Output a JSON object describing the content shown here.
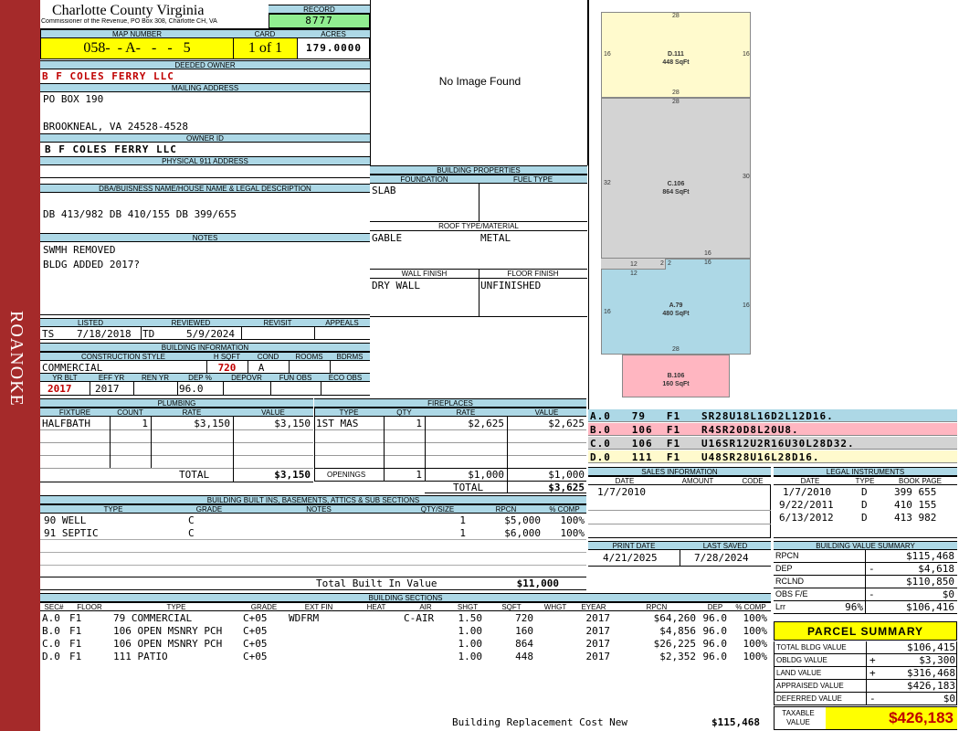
{
  "sidebar": {
    "label": "ROANOKE"
  },
  "county": {
    "name": "Charlotte County Virginia",
    "sub": "Commissioner of the Revenue, PO Box 308, Charlotte CH, VA"
  },
  "record": {
    "label": "RECORD",
    "value": "8777"
  },
  "map": {
    "label": "MAP NUMBER",
    "value": "058-  - A-   -   -   5",
    "card_label": "CARD",
    "card": "1 of 1",
    "acres_label": "ACRES",
    "acres": "179.0000"
  },
  "owner": {
    "deeded_label": "DEEDED OWNER",
    "deeded": "B F COLES FERRY LLC",
    "mailing_label": "MAILING ADDRESS",
    "addr1": "PO BOX 190",
    "addr2": "BROOKNEAL, VA 24528-4528",
    "id_label": "OWNER ID",
    "id_value": "B F COLES FERRY LLC",
    "phys_label": "PHYSICAL 911 ADDRESS"
  },
  "dba": {
    "label": "DBA/BUISNESS NAME/HOUSE NAME & LEGAL DESCRIPTION",
    "value": "DB 413/982 DB 410/155 DB 399/655"
  },
  "notes": {
    "label": "NOTES",
    "line1": "SWMH REMOVED",
    "line2": "BLDG ADDED 2017?"
  },
  "listed": {
    "h_listed": "LISTED",
    "h_reviewed": "REVIEWED",
    "h_revisit": "REVISIT",
    "h_appeals": "APPEALS",
    "lister": "TS",
    "listed_date": "7/18/2018",
    "reviewer": "TD",
    "reviewed_date": "5/9/2024"
  },
  "bldg_info": {
    "label": "BUILDING INFORMATION",
    "h_style": "CONSTRUCTION STYLE",
    "h_hsqft": "H SQFT",
    "h_cond": "COND",
    "h_rooms": "ROOMS",
    "h_bdrms": "BDRMS",
    "style": "COMMERCIAL",
    "hsqft": "720",
    "cond": "A",
    "h_yrblt": "YR BLT",
    "h_effyr": "EFF YR",
    "h_renyr": "REN YR",
    "h_dep": "DEP %",
    "h_depovr": "DEPOVR",
    "h_funobs": "FUN OBS",
    "h_ecoobs": "ECO OBS",
    "yrblt": "2017",
    "effyr": "2017",
    "dep": "96.0"
  },
  "plumbing": {
    "label": "PLUMBING",
    "h_fixture": "FIXTURE",
    "h_count": "COUNT",
    "h_rate": "RATE",
    "h_value": "VALUE",
    "fixture": "HALFBATH",
    "count": "1",
    "rate": "$3,150",
    "value": "$3,150",
    "total_label": "TOTAL",
    "total": "$3,150"
  },
  "fireplaces": {
    "label": "FIREPLACES",
    "h_type": "TYPE",
    "h_qty": "QTY",
    "h_rate": "RATE",
    "h_value": "VALUE",
    "type": "1ST MAS",
    "qty": "1",
    "rate": "$2,625",
    "value": "$2,625",
    "openings_label": "OPENINGS",
    "open_qty": "1",
    "open_rate": "$1,000",
    "open_value": "$1,000",
    "total_label": "TOTAL",
    "total": "$3,625"
  },
  "image": {
    "no_image": "No Image Found"
  },
  "bldg_props": {
    "label": "BUILDING PROPERTIES",
    "h_foundation": "FOUNDATION",
    "h_fuel": "FUEL TYPE",
    "foundation": "SLAB",
    "h_roof": "ROOF TYPE/MATERIAL",
    "roof1": "GABLE",
    "roof2": "METAL",
    "h_wall": "WALL FINISH",
    "h_floor": "FLOOR FINISH",
    "wall": "DRY WALL",
    "floor": "UNFINISHED"
  },
  "sketch": {
    "d": {
      "name": "D.111",
      "area": "448 SqFt",
      "top": "28",
      "left": "16",
      "right": "16",
      "bottom": "28"
    },
    "c": {
      "name": "C.106",
      "area": "864 SqFt",
      "top": "28",
      "left": "32",
      "right": "30",
      "s16": "16",
      "s12": "12",
      "s2a": "2",
      "s2b": "2",
      "s16b": "16"
    },
    "a": {
      "name": "A.79",
      "area": "480 SqFt",
      "left": "16",
      "right": "16",
      "top": "12",
      "bottom": "28"
    },
    "b": {
      "name": "B.106",
      "area": "160 SqFt"
    }
  },
  "sketch_legend": [
    {
      "text": "A.0   79   F1   SR28U18L16D2L12D16.",
      "color": "#add8e6"
    },
    {
      "text": "B.0   106  F1   R4SR20D8L20U8.",
      "color": "#ffb6c1"
    },
    {
      "text": "C.0   106  F1   U16SR12U2R16U30L28D32.",
      "color": "#d3d3d3"
    },
    {
      "text": "D.0   111  F1   U48SR28U16L28D16.",
      "color": "#fffacd"
    }
  ],
  "sales": {
    "label": "SALES INFORMATION",
    "h_date": "DATE",
    "h_amount": "AMOUNT",
    "h_code": "CODE",
    "date": "1/7/2010"
  },
  "legal": {
    "label": "LEGAL INSTRUMENTS",
    "h_date": "DATE",
    "h_type": "TYPE",
    "h_book": "BOOK PAGE",
    "rows": [
      {
        "date": "1/7/2010",
        "type": "D",
        "book": "399 655"
      },
      {
        "date": "9/22/2011",
        "type": "D",
        "book": "410 155"
      },
      {
        "date": "6/13/2012",
        "type": "D",
        "book": "413 982"
      }
    ]
  },
  "print": {
    "h_print": "PRINT DATE",
    "h_saved": "LAST SAVED",
    "print_date": "4/21/2025",
    "saved_date": "7/28/2024"
  },
  "bvs": {
    "label": "BUILDING VALUE SUMMARY",
    "rows": [
      {
        "k": "RPCN",
        "s": "",
        "v": "$115,468"
      },
      {
        "k": "DEP",
        "s": "-",
        "v": "$4,618"
      },
      {
        "k": "RCLND",
        "s": "",
        "v": "$110,850"
      },
      {
        "k": "OBS F/E",
        "s": "-",
        "v": "$0"
      },
      {
        "k": "Lrr",
        "p": "96%",
        "s": "",
        "v": "$106,416"
      }
    ]
  },
  "parcel": {
    "label": "PARCEL SUMMARY",
    "rows": [
      {
        "k": "TOTAL BLDG VALUE",
        "s": "",
        "v": "$106,415"
      },
      {
        "k": "OBLDG VALUE",
        "s": "+",
        "v": "$3,300"
      },
      {
        "k": "LAND VALUE",
        "s": "+",
        "v": "$316,468"
      },
      {
        "k": "APPRAISED VALUE",
        "s": "",
        "v": "$426,183"
      },
      {
        "k": "DEFERRED VALUE",
        "s": "-",
        "v": "$0"
      }
    ],
    "taxable_label1": "TAXABLE",
    "taxable_label2": "VALUE",
    "taxable": "$426,183"
  },
  "builtins": {
    "label": "BUILDING BUILT INS, BASEMENTS, ATTICS & SUB SECTIONS",
    "h_type": "TYPE",
    "h_grade": "GRADE",
    "h_notes": "NOTES",
    "h_qty": "QTY/SIZE",
    "h_rpcn": "RPCN",
    "h_comp": "% COMP",
    "rows": [
      {
        "type": "90 WELL",
        "grade": "C",
        "qty": "1",
        "rpcn": "$5,000",
        "comp": "100%"
      },
      {
        "type": "91 SEPTIC",
        "grade": "C",
        "qty": "1",
        "rpcn": "$6,000",
        "comp": "100%"
      }
    ],
    "total_label": "Total Built In Value",
    "total": "$11,000"
  },
  "sections": {
    "label": "BUILDING SECTIONS",
    "headers": [
      "SEC#",
      "FLOOR",
      "TYPE",
      "GRADE",
      "EXT FIN",
      "HEAT",
      "AIR",
      "SHGT",
      "SQFT",
      "WHGT",
      "EYEAR",
      "RPCN",
      "DEP",
      "% COMP"
    ],
    "rows": [
      {
        "sec": "A.0",
        "floor": "F1",
        "type": "79 COMMERCIAL",
        "grade": "C+05",
        "ext": "WDFRM",
        "heat": "",
        "air": "C-AIR",
        "shgt": "1.50",
        "sqft": "720",
        "whgt": "",
        "eyear": "2017",
        "rpcn": "$64,260",
        "dep": "96.0",
        "comp": "100%"
      },
      {
        "sec": "B.0",
        "floor": "F1",
        "type": "106 OPEN MSNRY PCH",
        "grade": "C+05",
        "ext": "",
        "heat": "",
        "air": "",
        "shgt": "1.00",
        "sqft": "160",
        "whgt": "",
        "eyear": "2017",
        "rpcn": "$4,856",
        "dep": "96.0",
        "comp": "100%"
      },
      {
        "sec": "C.0",
        "floor": "F1",
        "type": "106 OPEN MSNRY PCH",
        "grade": "C+05",
        "ext": "",
        "heat": "",
        "air": "",
        "shgt": "1.00",
        "sqft": "864",
        "whgt": "",
        "eyear": "2017",
        "rpcn": "$26,225",
        "dep": "96.0",
        "comp": "100%"
      },
      {
        "sec": "D.0",
        "floor": "F1",
        "type": "111 PATIO",
        "grade": "C+05",
        "ext": "",
        "heat": "",
        "air": "",
        "shgt": "1.00",
        "sqft": "448",
        "whgt": "",
        "eyear": "2017",
        "rpcn": "$2,352",
        "dep": "96.0",
        "comp": "100%"
      }
    ],
    "total_label": "Building Replacement Cost New",
    "total": "$115,468"
  }
}
